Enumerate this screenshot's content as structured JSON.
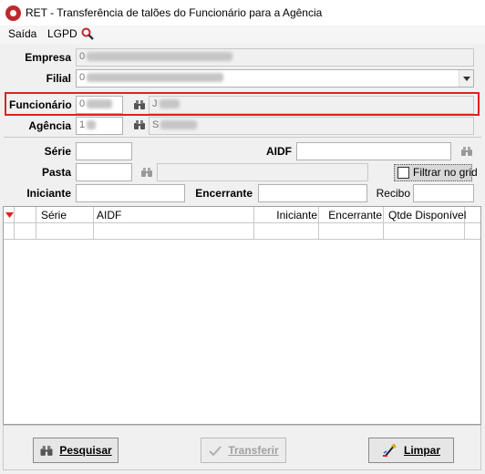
{
  "window": {
    "title": "RET - Transferência de talões do Funcionário para a Agência"
  },
  "menu": {
    "items": [
      "Saída",
      "LGPD"
    ],
    "icon": "search-icon"
  },
  "form": {
    "empresa": {
      "label": "Empresa",
      "value": "0"
    },
    "filial": {
      "label": "Filial",
      "value": "0"
    },
    "funcionario": {
      "label": "Funcionário",
      "code": "0",
      "name": "J"
    },
    "agencia": {
      "label": "Agência",
      "code": "1",
      "name": "S"
    }
  },
  "filters": {
    "serie": {
      "label": "Série",
      "value": ""
    },
    "aidf": {
      "label": "AIDF",
      "value": ""
    },
    "pasta": {
      "label": "Pasta",
      "value": "",
      "description": ""
    },
    "filtrar_no_grid": {
      "label": "Filtrar no grid",
      "checked": false
    },
    "iniciante": {
      "label": "Iniciante",
      "value": ""
    },
    "encerrante": {
      "label": "Encerrante",
      "value": ""
    },
    "recibo": {
      "label": "Recibo",
      "value": ""
    }
  },
  "grid": {
    "columns": [
      "Série",
      "AIDF",
      "Iniciante",
      "Encerrante",
      "Qtde Disponível"
    ]
  },
  "buttons": {
    "pesquisar": "Pesquisar",
    "transferir": "Transferir",
    "limpar": "Limpar"
  },
  "colors": {
    "highlight_box": "#e02020",
    "brand": "#c0282d"
  }
}
